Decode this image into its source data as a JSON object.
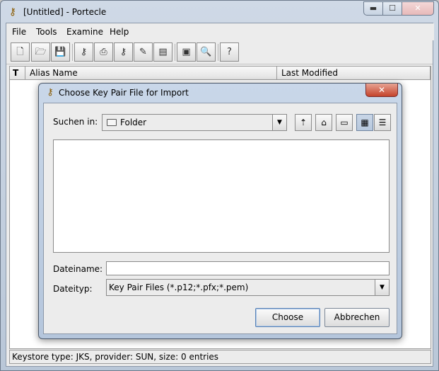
{
  "window": {
    "title": "[Untitled] - Portecle",
    "app_icon": "portecle-keys-icon"
  },
  "caption_buttons": {
    "minimize": "▬",
    "maximize": "☐",
    "close": "✕"
  },
  "menubar": {
    "items": [
      {
        "label": "File",
        "mnemonic": "F"
      },
      {
        "label": "Tools",
        "mnemonic": "T"
      },
      {
        "label": "Examine",
        "mnemonic": "E"
      },
      {
        "label": "Help",
        "mnemonic": "H"
      }
    ]
  },
  "toolbar": {
    "buttons": [
      {
        "name": "new-keystore-icon",
        "glyph": "🗋"
      },
      {
        "name": "open-keystore-icon",
        "glyph": "🗁"
      },
      {
        "name": "save-keystore-icon",
        "glyph": "💾"
      },
      {
        "name": "generate-keypair-icon",
        "glyph": "⚷"
      },
      {
        "name": "import-certificate-icon",
        "glyph": "⎙"
      },
      {
        "name": "import-keypair-icon",
        "glyph": "⚷"
      },
      {
        "name": "set-password-icon",
        "glyph": "✎"
      },
      {
        "name": "keystore-report-icon",
        "glyph": "▤"
      },
      {
        "name": "examine-certificate-icon",
        "glyph": "▣"
      },
      {
        "name": "examine-ssl-icon",
        "glyph": "🔍"
      },
      {
        "name": "help-icon",
        "glyph": "?"
      }
    ]
  },
  "table": {
    "columns": [
      "Alias Name",
      "Last Modified"
    ],
    "type_column_glyph": "T"
  },
  "status_bar": {
    "text": "Keystore type: JKS, provider: SUN, size: 0 entries"
  },
  "dialog": {
    "title": "Choose Key Pair File for Import",
    "close_glyph": "✕",
    "look_in_label": "Suchen in:",
    "look_in_value": "Folder",
    "filename_label": "Dateiname:",
    "filename_value": "",
    "filetype_label": "Dateityp:",
    "filetype_value": "Key Pair Files (*.p12;*.pfx;*.pem)",
    "choose_button": "Choose",
    "cancel_button": "Abbrechen",
    "nav_buttons": [
      {
        "name": "up-folder-icon",
        "glyph": "⇡"
      },
      {
        "name": "home-folder-icon",
        "glyph": "⌂"
      },
      {
        "name": "new-folder-icon",
        "glyph": "▭"
      },
      {
        "name": "list-view-icon",
        "glyph": "▦"
      },
      {
        "name": "details-view-icon",
        "glyph": "☰"
      }
    ]
  }
}
